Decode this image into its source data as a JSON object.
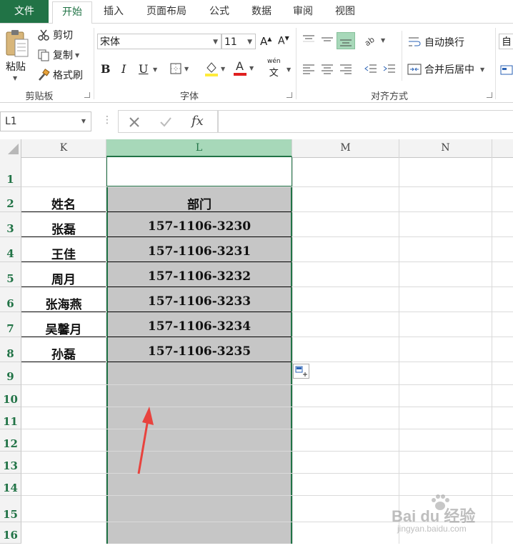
{
  "tabs": [
    "文件",
    "开始",
    "插入",
    "页面布局",
    "公式",
    "数据",
    "审阅",
    "视图"
  ],
  "active_tab": "开始",
  "clipboard": {
    "paste_label": "粘贴",
    "cut_label": "剪切",
    "copy_label": "复制",
    "format_painter_label": "格式刷",
    "group_label": "剪贴板"
  },
  "font": {
    "font_name": "宋体",
    "font_size": "11",
    "group_label": "字体",
    "bold": "B",
    "italic": "I",
    "underline": "U",
    "phonetic": "wén"
  },
  "alignment": {
    "wrap_text_label": "自动换行",
    "merge_center_label": "合并后居中",
    "group_label": "对齐方式",
    "cut_off_right": "自"
  },
  "formula_bar": {
    "name_box": "L1",
    "fx": "fx",
    "formula": ""
  },
  "columns": [
    "K",
    "L",
    "M",
    "N"
  ],
  "selected_column": "L",
  "rows": [
    "1",
    "2",
    "3",
    "4",
    "5",
    "6",
    "7",
    "8",
    "9",
    "10",
    "11",
    "12",
    "13",
    "14",
    "15",
    "16"
  ],
  "table": {
    "header_name": "姓名",
    "header_dept": "部门",
    "names": [
      "张磊",
      "王佳",
      "周月",
      "张海燕",
      "吴馨月",
      "孙磊"
    ],
    "depts": [
      "157-1106-3230",
      "157-1106-3231",
      "157-1106-3232",
      "157-1106-3233",
      "157-1106-3234",
      "157-1106-3235"
    ]
  },
  "watermark": {
    "logo_text": "Bai du 经验",
    "url": "jingyan.baidu.com"
  },
  "colors": {
    "excel_green": "#217346",
    "selection_fill": "#c6c6c6",
    "arrow_red": "#e8433e"
  }
}
